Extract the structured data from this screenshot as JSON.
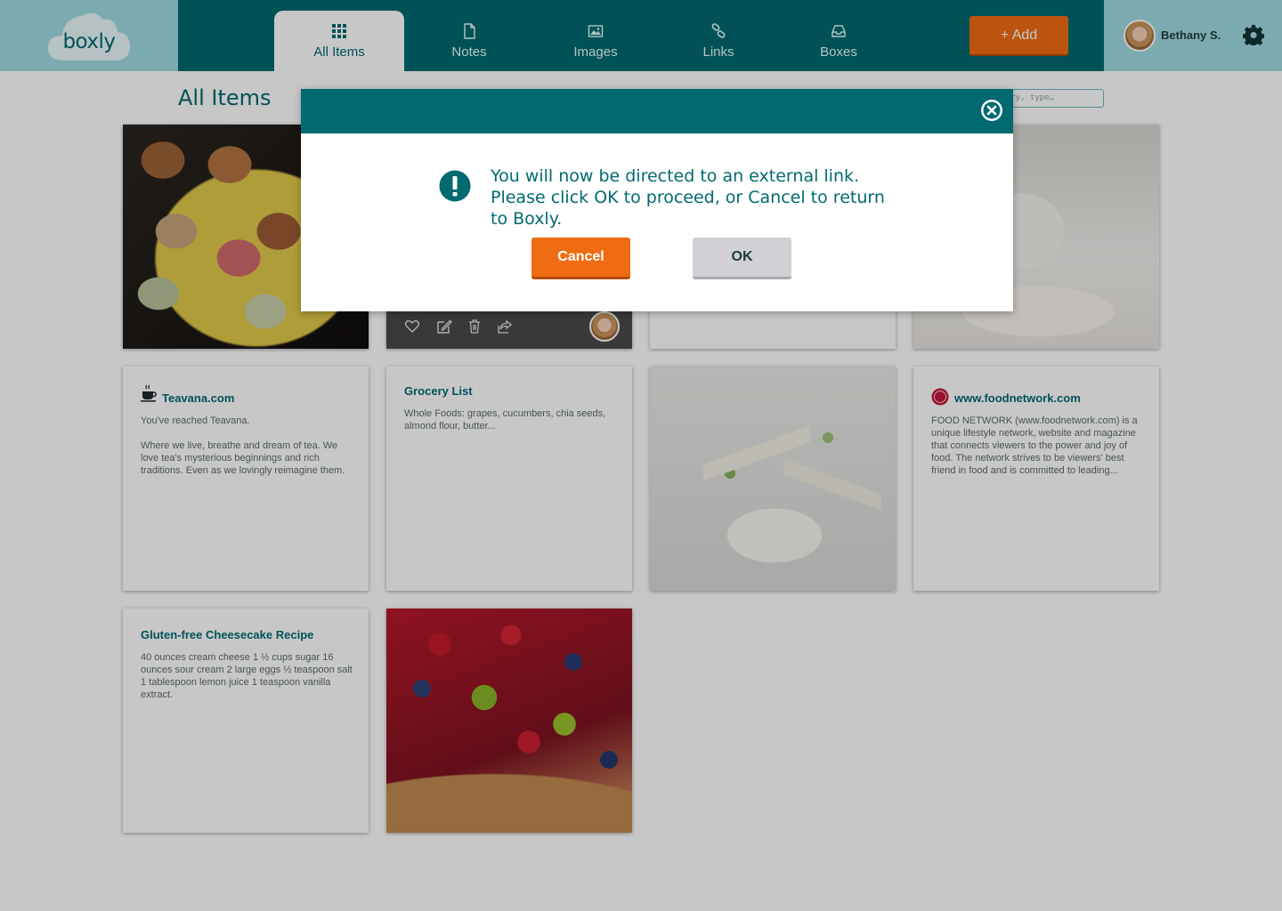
{
  "header": {
    "logo_text": "boxly",
    "tabs": [
      {
        "label": "All Items",
        "icon": "grid-icon",
        "active": true
      },
      {
        "label": "Notes",
        "icon": "document-icon"
      },
      {
        "label": "Images",
        "icon": "image-icon"
      },
      {
        "label": "Links",
        "icon": "link-icon"
      },
      {
        "label": "Boxes",
        "icon": "inbox-icon"
      }
    ],
    "add_label": "+ Add",
    "user_name": "Bethany S.",
    "settings_icon": "gear-icon"
  },
  "page": {
    "title": "All Items",
    "search_placeholder": "egory, type…"
  },
  "cards": {
    "teavana": {
      "title": "Teavana.com",
      "text": "You've reached Teavana.\n\nWhere we live, breathe and dream of tea. We love tea's mysterious beginnings and rich traditions. Even as we lovingly reimagine them."
    },
    "grocery": {
      "title": "Grocery List",
      "text": "Whole Foods: grapes, cucumbers, chia seeds, almond flour, butter..."
    },
    "foodnetwork": {
      "title": "www.foodnetwork.com",
      "text": "FOOD NETWORK (www.foodnetwork.com) is a unique lifestyle network, website and magazine that connects viewers to the power and joy of food. The network strives to be viewers' best friend in food and is committed to leading..."
    },
    "cheesecake": {
      "title": "Gluten-free Cheesecake Recipe",
      "text": "40 ounces cream cheese 1 ½ cups sugar 16 ounces sour cream 2 large eggs ½ teaspoon salt 1 tablespoon lemon juice 1 teaspoon vanilla extract."
    }
  },
  "modal": {
    "message": "You will now be directed to an external link. Please click OK to proceed, or Cancel to return to Boxly.",
    "cancel_label": "Cancel",
    "ok_label": "OK"
  },
  "colors": {
    "brand_teal": "#006a70",
    "accent_orange": "#ef6c12",
    "light_teal": "#9fdbe0"
  }
}
